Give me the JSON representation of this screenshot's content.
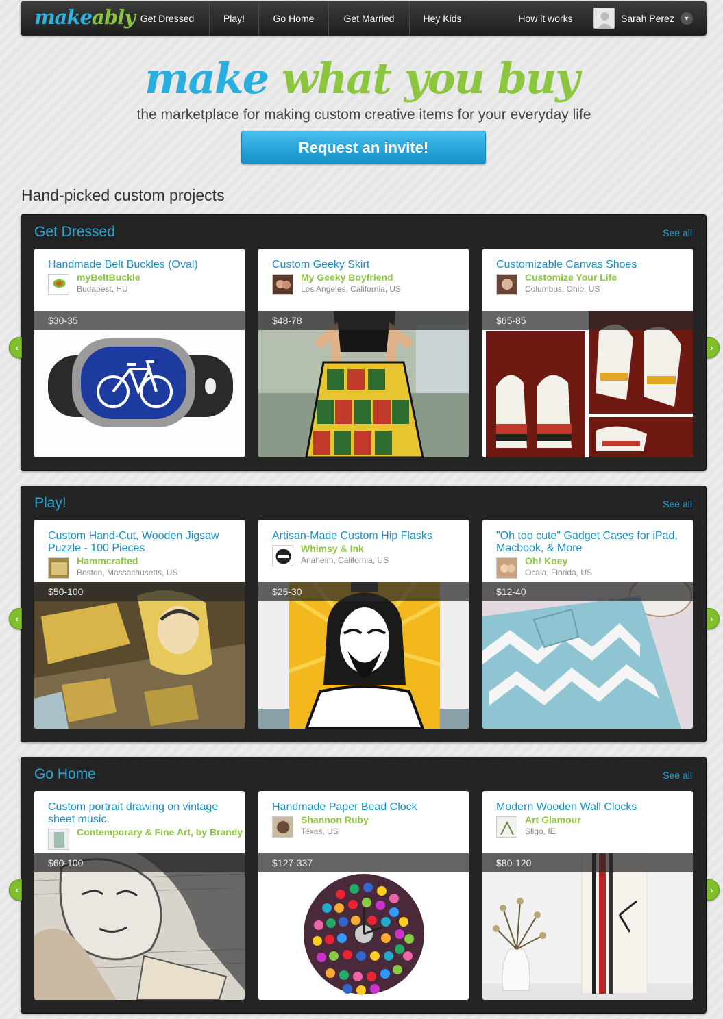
{
  "nav": {
    "logo_part1": "make",
    "logo_part2": "ably",
    "items": [
      "Get Dressed",
      "Play!",
      "Go Home",
      "Get Married",
      "Hey Kids",
      "How it works"
    ],
    "user_name": "Sarah Perez"
  },
  "hero": {
    "title_blue": "make",
    "title_green": "what you buy",
    "subtitle": "the marketplace for making custom creative items for your everyday life",
    "cta": "Request an invite!"
  },
  "section_heading": "Hand-picked custom projects",
  "see_all_label": "See all",
  "arrow_left": "‹",
  "arrow_right": "›",
  "categories": [
    {
      "title": "Get Dressed",
      "products": [
        {
          "title": "Handmade Belt Buckles (Oval)",
          "seller": "myBeltBuckle",
          "location": "Budapest, HU",
          "price": "$30-35"
        },
        {
          "title": "Custom Geeky Skirt",
          "seller": "My Geeky Boyfriend",
          "location": "Los Angeles, California, US",
          "price": "$48-78"
        },
        {
          "title": "Customizable Canvas Shoes",
          "seller": "Customize Your Life",
          "location": "Columbus, Ohio, US",
          "price": "$65-85"
        }
      ]
    },
    {
      "title": "Play!",
      "products": [
        {
          "title": "Custom Hand-Cut, Wooden Jigsaw Puzzle - 100 Pieces",
          "seller": "Hammcrafted",
          "location": "Boston, Massachusetts, US",
          "price": "$50-100"
        },
        {
          "title": "Artisan-Made Custom Hip Flasks",
          "seller": "Whimsy & Ink",
          "location": "Anaheim, California, US",
          "price": "$25-30"
        },
        {
          "title": "\"Oh too cute\" Gadget Cases for iPad, Macbook, & More",
          "seller": "Oh! Koey",
          "location": "Ocala, Florida, US",
          "price": "$12-40"
        }
      ]
    },
    {
      "title": "Go Home",
      "products": [
        {
          "title": "Custom portrait drawing on vintage sheet music.",
          "seller": "Contemporary & Fine Art, by Brandy Cattoor",
          "location": "",
          "price": "$60-100"
        },
        {
          "title": "Handmade Paper Bead Clock",
          "seller": "Shannon Ruby",
          "location": "Texas, US",
          "price": "$127-337"
        },
        {
          "title": "Modern Wooden Wall Clocks",
          "seller": "Art Glamour",
          "location": "Sligo, IE",
          "price": "$80-120"
        }
      ]
    }
  ],
  "colors": {
    "brand_blue": "#29aee0",
    "brand_green": "#8cc63f",
    "panel_bg": "#242424"
  }
}
